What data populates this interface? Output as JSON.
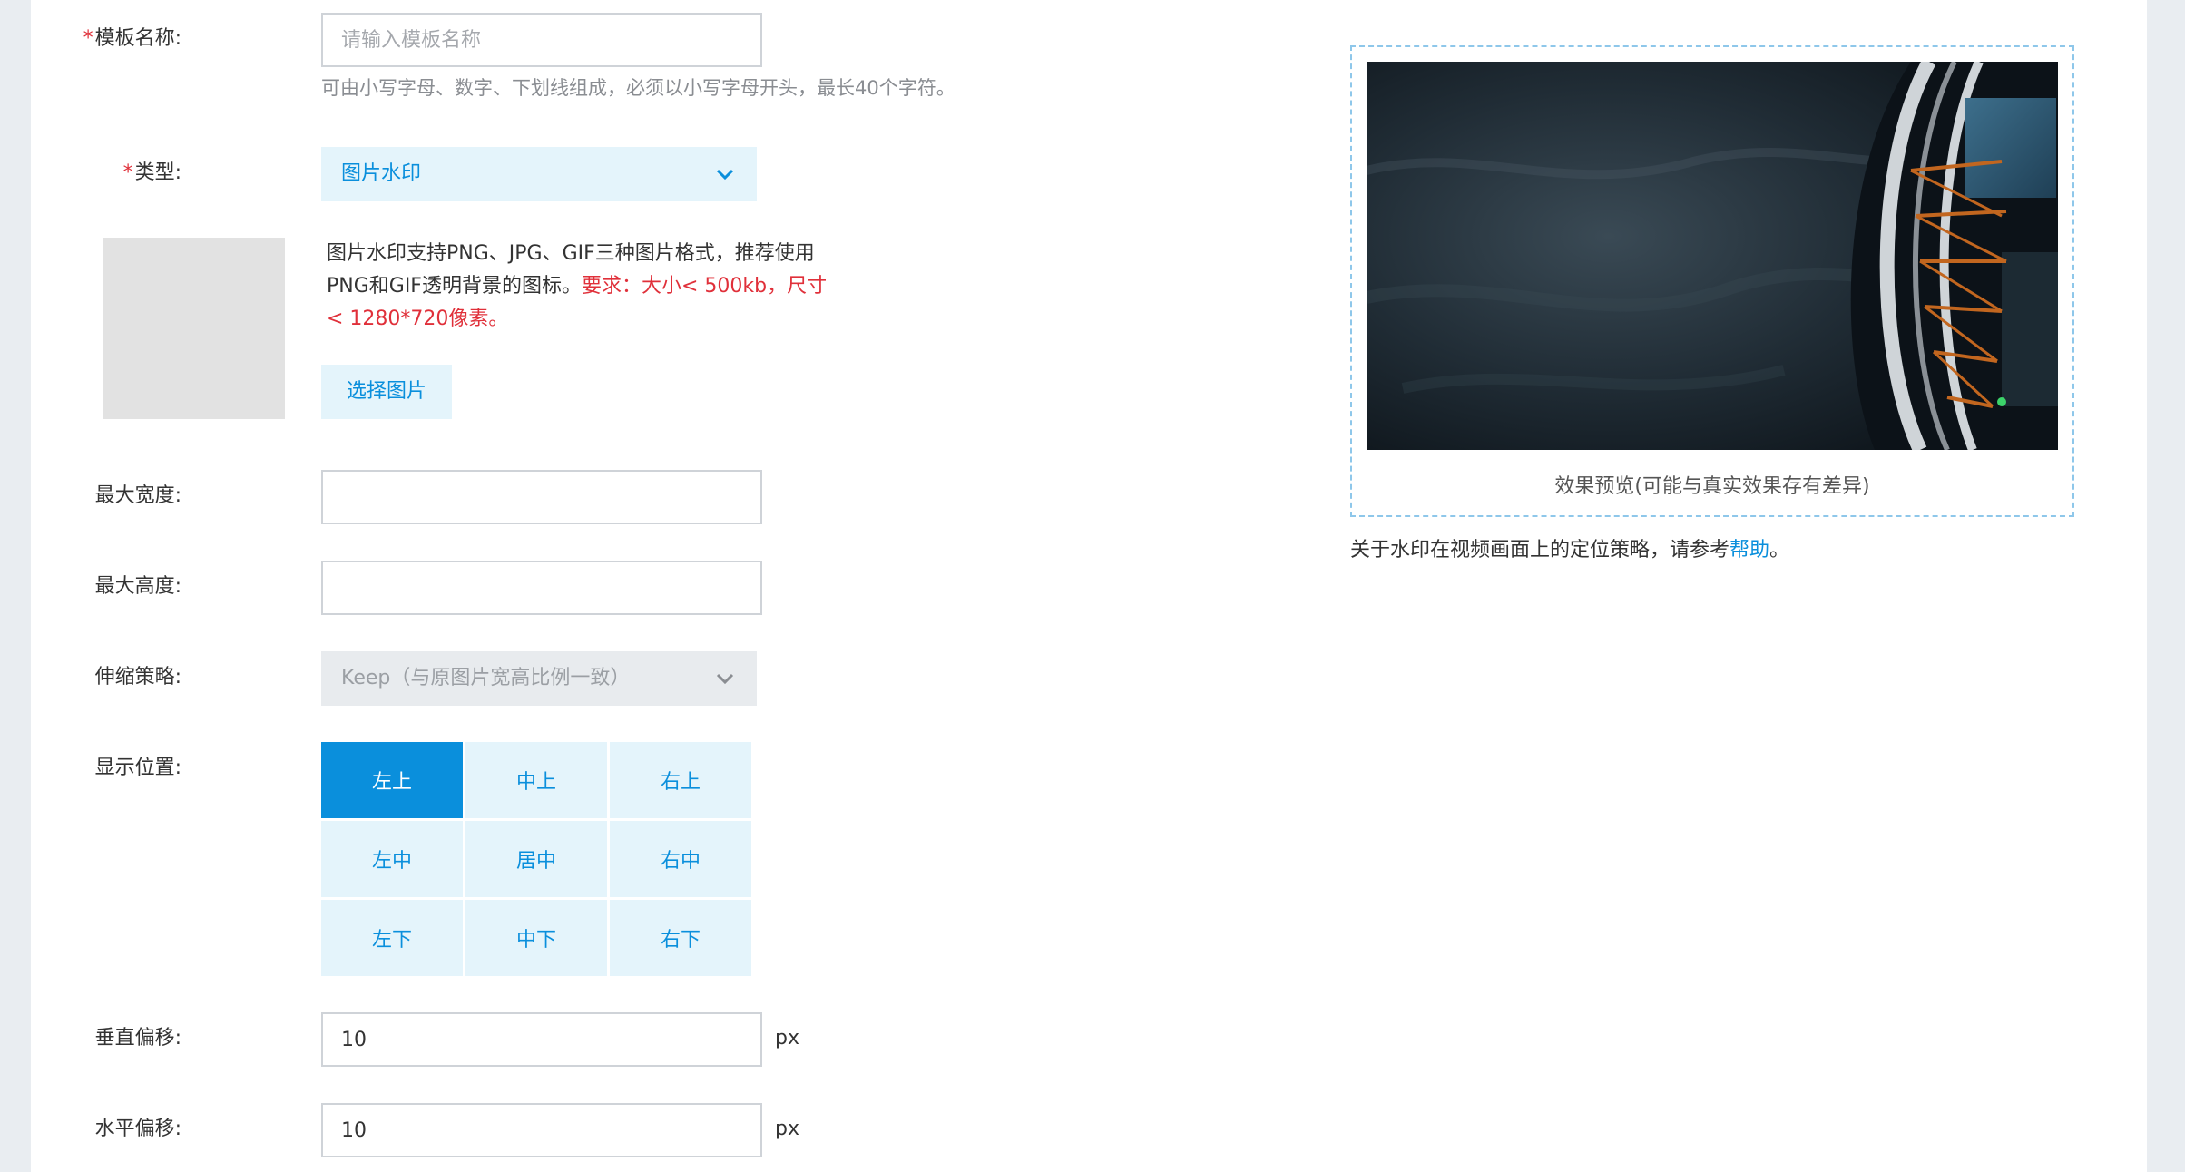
{
  "form": {
    "template_name": {
      "label": "模板名称:",
      "required_mark": "*",
      "placeholder": "请输入模板名称",
      "hint": "可由小写字母、数字、下划线组成，必须以小写字母开头，最长40个字符。"
    },
    "type": {
      "label": "类型:",
      "required_mark": "*",
      "selected": "图片水印"
    },
    "image_upload": {
      "desc_line1": "图片水印支持PNG、JPG、GIF三种图片格式，推荐使用",
      "desc_line2_prefix": "PNG和GIF透明背景的图标。",
      "desc_line2_warn": "要求：大小< 500kb，尺寸",
      "desc_line3_warn": "< 1280*720像素。",
      "choose_button": "选择图片"
    },
    "max_width": {
      "label": "最大宽度:",
      "value": ""
    },
    "max_height": {
      "label": "最大高度:",
      "value": ""
    },
    "scale_policy": {
      "label": "伸缩策略:",
      "selected": "Keep（与原图片宽高比例一致）"
    },
    "position": {
      "label": "显示位置:",
      "options": [
        "左上",
        "中上",
        "右上",
        "左中",
        "居中",
        "右中",
        "左下",
        "中下",
        "右下"
      ],
      "selected": "左上"
    },
    "vertical_offset": {
      "label": "垂直偏移:",
      "value": "10",
      "unit": "px"
    },
    "horizontal_offset": {
      "label": "水平偏移:",
      "value": "10",
      "unit": "px"
    }
  },
  "preview": {
    "caption": "效果预览(可能与真实效果存有差异)",
    "note_prefix": "关于水印在视频画面上的定位策略，请参考",
    "note_link": "帮助",
    "note_suffix": "。"
  },
  "colors": {
    "accent": "#0a8fdc",
    "required": "#e0303a",
    "light_accent_bg": "#e4f4fb"
  }
}
